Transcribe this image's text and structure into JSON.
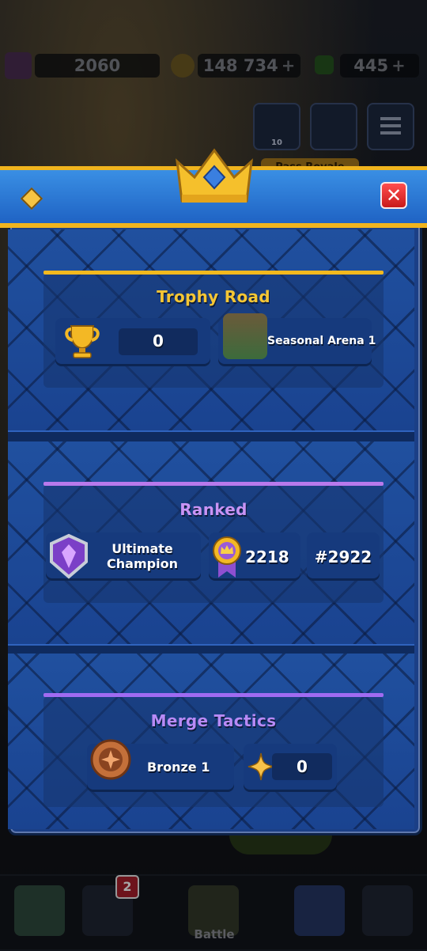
{
  "top_bar": {
    "trophies": "2060",
    "gold": "148 734",
    "gold_plus": "+",
    "gems": "445",
    "gems_plus": "+"
  },
  "friends_badge": "10",
  "mode_tab": "Pass Royale",
  "sections": {
    "trophy_road": {
      "title": "Trophy Road",
      "trophies": "0",
      "arena": "Seasonal Arena 1"
    },
    "ranked": {
      "title": "Ranked",
      "league": "Ultimate Champion",
      "rating": "2218",
      "rank": "#2922"
    },
    "merge_tactics": {
      "title": "Merge Tactics",
      "league": "Bronze 1",
      "points": "0"
    }
  },
  "close_label": "✕",
  "bottom_nav": {
    "cards_badge": "2",
    "battle_label": "Battle"
  },
  "colors": {
    "trophy_road_accent": "#f2b91e",
    "ranked_accent": "#b879ec",
    "merge_accent": "#a06bf2",
    "panel_header": "#2a7ad8",
    "gold_border": "#f0b41e"
  }
}
